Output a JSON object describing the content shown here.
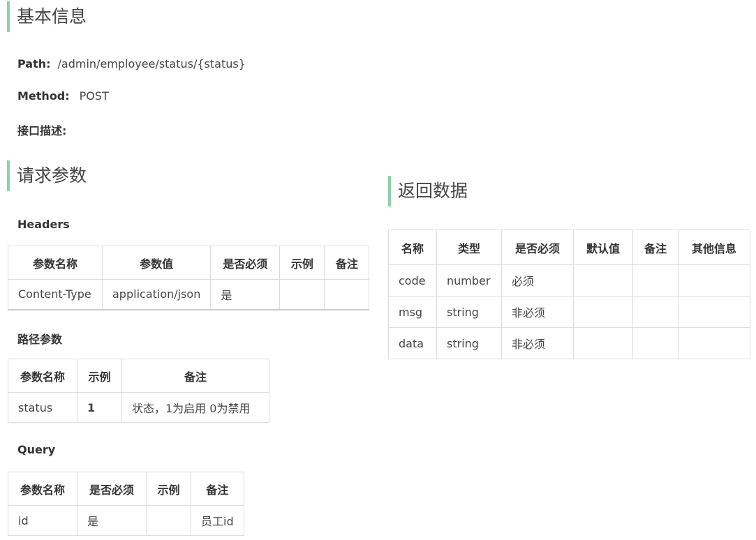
{
  "basic": {
    "heading": "基本信息",
    "path_label": "Path:",
    "path_value": "/admin/employee/status/{status}",
    "method_label": "Method:",
    "method_value": "POST",
    "desc_label": "接口描述:"
  },
  "request": {
    "heading": "请求参数",
    "headers_title": "Headers",
    "headers_table": {
      "columns": [
        "参数名称",
        "参数值",
        "是否必须",
        "示例",
        "备注"
      ],
      "rows": [
        [
          "Content-Type",
          "application/json",
          "是",
          "",
          ""
        ]
      ]
    },
    "path_title": "路径参数",
    "path_table": {
      "columns": [
        "参数名称",
        "示例",
        "备注"
      ],
      "rows": [
        [
          "status",
          "1",
          "状态，1为启用 0为禁用"
        ]
      ]
    },
    "query_title": "Query",
    "query_table": {
      "columns": [
        "参数名称",
        "是否必须",
        "示例",
        "备注"
      ],
      "rows": [
        [
          "id",
          "是",
          "",
          "员工id"
        ]
      ]
    }
  },
  "response": {
    "heading": "返回数据",
    "table": {
      "columns": [
        "名称",
        "类型",
        "是否必须",
        "默认值",
        "备注",
        "其他信息"
      ],
      "rows": [
        [
          "code",
          "number",
          "必须",
          "",
          "",
          ""
        ],
        [
          "msg",
          "string",
          "非必须",
          "",
          "",
          ""
        ],
        [
          "data",
          "string",
          "非必须",
          "",
          "",
          ""
        ]
      ]
    }
  }
}
